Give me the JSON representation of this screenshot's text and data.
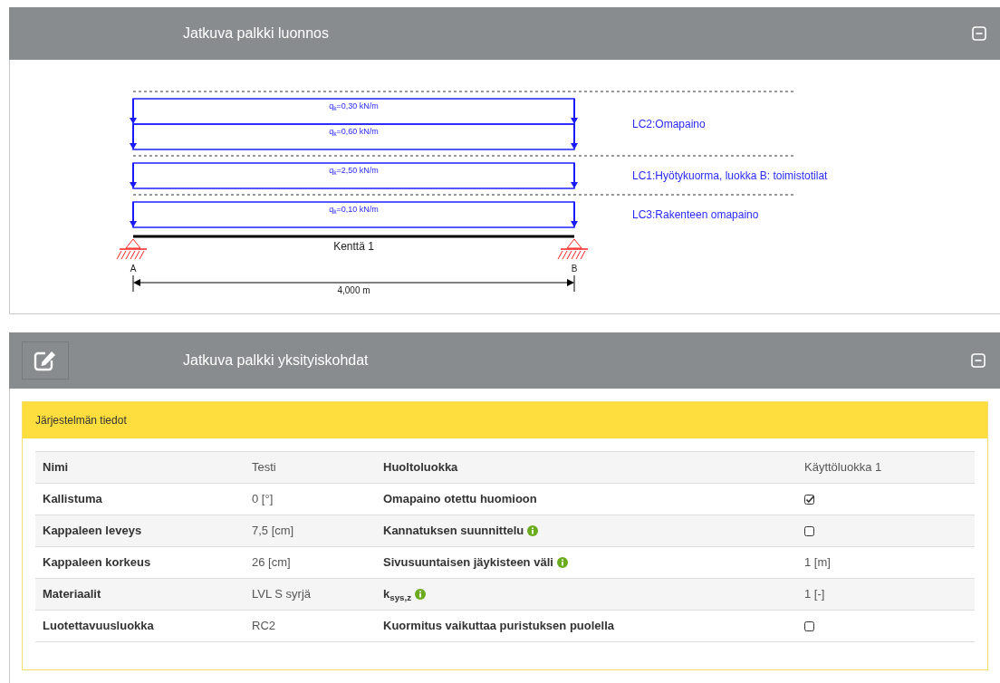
{
  "sketch_panel": {
    "title": "Jatkuva palkki luonnos",
    "load_cases": [
      {
        "label": "LC2:Omapaino",
        "loads": [
          "q$_{k}$=0,30 kN/m",
          "q$_{k}$=0,60 kN/m"
        ]
      },
      {
        "label": "LC1:Hyötykuorma, luokka B: toimistotilat",
        "loads": [
          "q$_{k}$=2,50 kN/m"
        ]
      },
      {
        "label": "LC3:Rakenteen omapaino",
        "loads": [
          "q$_{k}$=0,10 kN/m"
        ]
      }
    ],
    "span_label": "Kenttä 1",
    "supports": [
      "A",
      "B"
    ],
    "dimension": "4,000 m"
  },
  "details_panel": {
    "title": "Jatkuva palkki yksityiskohdat",
    "section_title": "Järjestelmän tiedot",
    "rows": [
      {
        "name": "Nimi",
        "value": "Testi",
        "name2": "Huoltoluokka",
        "info": false,
        "value2": {
          "kind": "text",
          "text": "Käyttöluokka 1"
        }
      },
      {
        "name": "Kallistuma",
        "value": "0 [°]",
        "name2": "Omapaino otettu huomioon",
        "info": false,
        "value2": {
          "kind": "checkbox",
          "checked": true
        }
      },
      {
        "name": "Kappaleen leveys",
        "value": "7,5 [cm]",
        "name2": "Kannatuksen suunnittelu",
        "info": true,
        "value2": {
          "kind": "checkbox",
          "checked": false
        }
      },
      {
        "name": "Kappaleen korkeus",
        "value": "26 [cm]",
        "name2": "Sivusuuntaisen jäykisteen väli",
        "info": true,
        "value2": {
          "kind": "text",
          "text": "1 [m]"
        }
      },
      {
        "name": "Materiaalit",
        "value": "LVL S syrjä",
        "name2": "k$_{sys,z}$",
        "info": true,
        "value2": {
          "kind": "text",
          "text": "1 [-]"
        }
      },
      {
        "name": "Luotettavuusluokka",
        "value": "RC2",
        "name2": "Kuormitus vaikuttaa puristuksen puolella",
        "info": false,
        "value2": {
          "kind": "checkbox",
          "checked": false
        }
      }
    ]
  }
}
